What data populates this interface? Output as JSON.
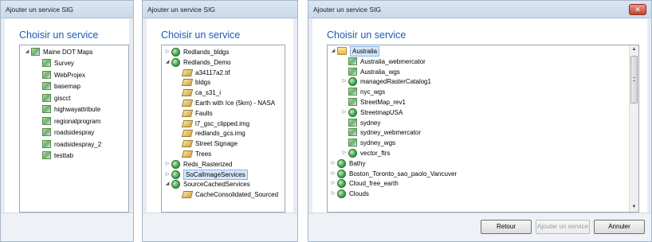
{
  "dialog1": {
    "title": "Ajouter un service SIG",
    "heading": "Choisir un service",
    "root": {
      "label": "Maine DOT Maps",
      "expanded": true
    },
    "items": [
      "Survey",
      "WebProjex",
      "basemap",
      "giscct",
      "highwayattribute",
      "regionalprogram",
      "roadsidespray",
      "roadsidespray_2",
      "testtab"
    ]
  },
  "dialog2": {
    "title": "Ajouter un service SIG",
    "heading": "Choisir un service",
    "rows": [
      {
        "label": "Redlands_bldgs",
        "icon": "globe-icon",
        "level": 0,
        "toggle": "collapsed"
      },
      {
        "label": "Redlands_Demo",
        "icon": "globe-icon",
        "level": 0,
        "toggle": "expanded"
      },
      {
        "label": "a34117a2.tif",
        "icon": "raster-icon",
        "level": 1,
        "toggle": "none"
      },
      {
        "label": "bldgs",
        "icon": "raster-icon",
        "level": 1,
        "toggle": "none"
      },
      {
        "label": "ca_s31_i",
        "icon": "raster-icon",
        "level": 1,
        "toggle": "none"
      },
      {
        "label": "Earth with Ice (5km) - NASA",
        "icon": "raster-icon",
        "level": 1,
        "toggle": "none"
      },
      {
        "label": "Faults",
        "icon": "raster-icon",
        "level": 1,
        "toggle": "none"
      },
      {
        "label": "l7_gsc_clipped.img",
        "icon": "raster-icon",
        "level": 1,
        "toggle": "none"
      },
      {
        "label": "redlands_gcs.img",
        "icon": "raster-icon",
        "level": 1,
        "toggle": "none"
      },
      {
        "label": "Street Signage",
        "icon": "raster-icon",
        "level": 1,
        "toggle": "none"
      },
      {
        "label": "Trees",
        "icon": "raster-icon",
        "level": 1,
        "toggle": "none"
      },
      {
        "label": "Reds_Rasterized",
        "icon": "globe-icon",
        "level": 0,
        "toggle": "collapsed"
      },
      {
        "label": "SoCalImageServices",
        "icon": "globe-icon",
        "level": 0,
        "toggle": "collapsed",
        "selected": true
      },
      {
        "label": "SourceCachedServices",
        "icon": "globe-icon",
        "level": 0,
        "toggle": "expanded"
      },
      {
        "label": "CacheConsolidated_Sourced",
        "icon": "raster-icon",
        "level": 1,
        "toggle": "none"
      }
    ]
  },
  "dialog3": {
    "title": "Ajouter un service SIG",
    "heading": "Choisir un service",
    "close_glyph": "✕",
    "rows": [
      {
        "label": "Australia",
        "icon": "folder-icon",
        "level": 0,
        "toggle": "expanded",
        "selected": true
      },
      {
        "label": "Australia_webmercator",
        "icon": "mapdoc-icon",
        "level": 1,
        "toggle": "none"
      },
      {
        "label": "Australia_wgs",
        "icon": "mapdoc-icon",
        "level": 1,
        "toggle": "none"
      },
      {
        "label": "managedRasterCatalog1",
        "icon": "globe-icon",
        "level": 1,
        "toggle": "collapsed"
      },
      {
        "label": "nyc_wgs",
        "icon": "mapdoc-icon",
        "level": 1,
        "toggle": "none"
      },
      {
        "label": "StreetMap_rev1",
        "icon": "mapdoc-icon",
        "level": 1,
        "toggle": "none"
      },
      {
        "label": "StreetmapUSA",
        "icon": "globe-icon",
        "level": 1,
        "toggle": "collapsed"
      },
      {
        "label": "sydney",
        "icon": "mapdoc-icon",
        "level": 1,
        "toggle": "none"
      },
      {
        "label": "sydney_webmercator",
        "icon": "mapdoc-icon",
        "level": 1,
        "toggle": "none"
      },
      {
        "label": "sydney_wgs",
        "icon": "mapdoc-icon",
        "level": 1,
        "toggle": "none"
      },
      {
        "label": "vector_ftrs",
        "icon": "globe-icon",
        "level": 1,
        "toggle": "collapsed"
      },
      {
        "label": "Bathy",
        "icon": "globe-icon",
        "level": 0,
        "toggle": "collapsed"
      },
      {
        "label": "Boston_Toronto_sao_paolo_Vancuver",
        "icon": "globe-icon",
        "level": 0,
        "toggle": "collapsed"
      },
      {
        "label": "Cloud_free_earth",
        "icon": "globe-icon",
        "level": 0,
        "toggle": "collapsed"
      },
      {
        "label": "Clouds",
        "icon": "globe-icon",
        "level": 0,
        "toggle": "collapsed"
      }
    ],
    "buttons": {
      "back": "Retour",
      "add": "Ajouter un service",
      "cancel": "Annuler"
    }
  },
  "glyphs": {
    "expanded": "◢",
    "collapsed": "▷",
    "scroll_up": "▲",
    "scroll_down": "▼"
  },
  "colors": {
    "heading": "#1b5bb6",
    "selection": "#d7e8fb",
    "selection_border": "#85b4e8"
  }
}
